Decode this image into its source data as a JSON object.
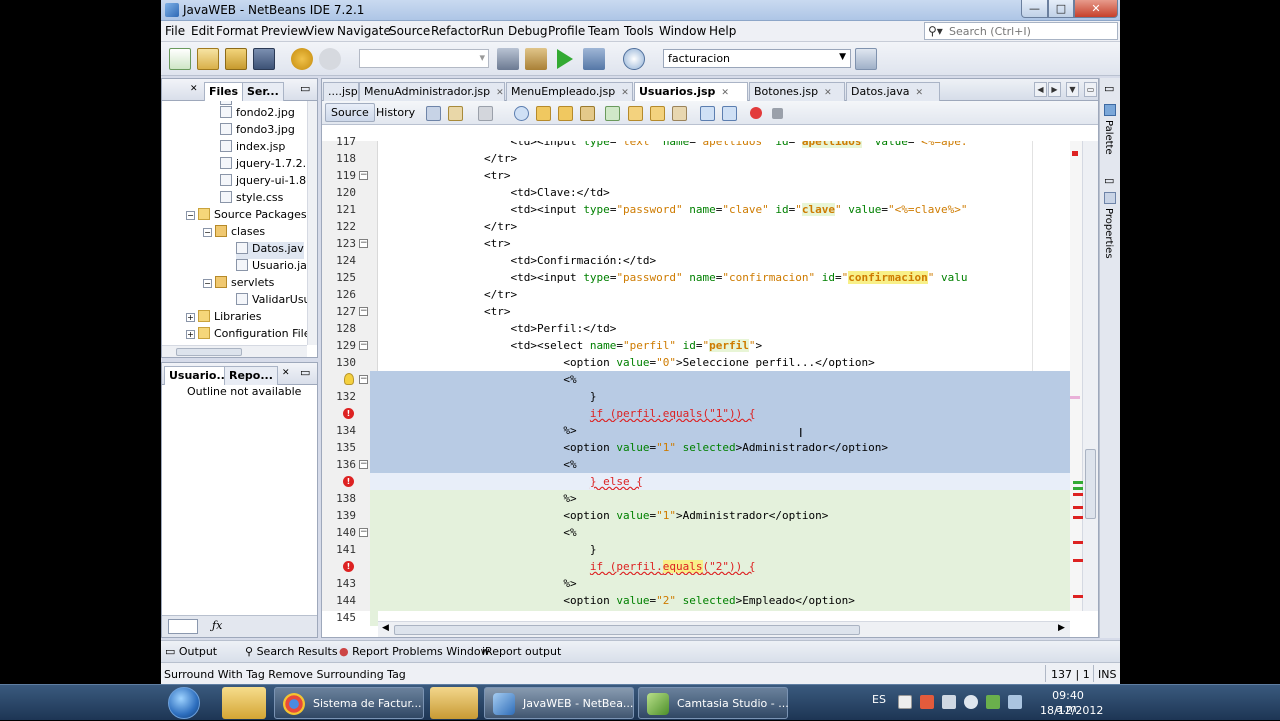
{
  "window": {
    "title": "JavaWEB - NetBeans IDE 7.2.1",
    "minimize": "—",
    "maximize": "□",
    "close": "✕"
  },
  "menu": [
    "File",
    "Edit",
    "Format",
    "Preview",
    "View",
    "Navigate",
    "Source",
    "Refactor",
    "Run",
    "Debug",
    "Profile",
    "Team",
    "Tools",
    "Window",
    "Help"
  ],
  "search": {
    "placeholder": "Search (Ctrl+I)"
  },
  "toolbar": {
    "project_combo": "facturacion"
  },
  "left_panel": {
    "tabs": [
      "Files",
      "Ser..."
    ],
    "tree": [
      {
        "label": "fondo2.jpg",
        "kind": "file"
      },
      {
        "label": "fondo3.jpg",
        "kind": "file"
      },
      {
        "label": "index.jsp",
        "kind": "file"
      },
      {
        "label": "jquery-1.7.2.",
        "kind": "file"
      },
      {
        "label": "jquery-ui-1.8",
        "kind": "file"
      },
      {
        "label": "style.css",
        "kind": "file"
      },
      {
        "label": "Source Packages",
        "kind": "folder"
      },
      {
        "label": "clases",
        "kind": "pkg"
      },
      {
        "label": "Datos.jav",
        "kind": "file"
      },
      {
        "label": "Usuario.ja",
        "kind": "file"
      },
      {
        "label": "servlets",
        "kind": "pkg"
      },
      {
        "label": "ValidarUsu",
        "kind": "file"
      },
      {
        "label": "Libraries",
        "kind": "folder"
      },
      {
        "label": "Configuration File",
        "kind": "folder"
      }
    ]
  },
  "navigator": {
    "tabs": [
      "Usuario...",
      "Repo..."
    ],
    "note": "Outline not available"
  },
  "editor": {
    "tabs": [
      {
        "label": "....jsp"
      },
      {
        "label": "MenuAdministrador.jsp"
      },
      {
        "label": "MenuEmpleado.jsp"
      },
      {
        "label": "Usuarios.jsp",
        "active": true
      },
      {
        "label": "Botones.jsp"
      },
      {
        "label": "Datos.java"
      }
    ],
    "source_tab": "Source",
    "history_tab": "History",
    "lines": [
      {
        "n": "117",
        "html": "                    &lt;td&gt;&lt;input <span class='a'>type</span>=<span class='v'>\"text\"</span> <span class='a'>name</span>=<span class='v'>\"apellidos\"</span> <span class='a'>id</span>=<span class='v'>\"<b class='hl-occ'>apellidos</b>\"</span> <span class='a'>value</span>=<span class='v'>\"&lt;%=ape:</span>"
      },
      {
        "n": "118",
        "html": "                &lt;/tr&gt;"
      },
      {
        "n": "119",
        "html": "                &lt;tr&gt;",
        "fold": true
      },
      {
        "n": "120",
        "html": "                    &lt;td&gt;Clave:&lt;/td&gt;"
      },
      {
        "n": "121",
        "html": "                    &lt;td&gt;&lt;input <span class='a'>type</span>=<span class='v'>\"password\"</span> <span class='a'>name</span>=<span class='v'>\"clave\"</span> <span class='a'>id</span>=<span class='v'>\"<b class='hl-occ'>clave</b>\"</span> <span class='a'>value</span>=<span class='v'>\"&lt;%=clave%&gt;\"</span>"
      },
      {
        "n": "122",
        "html": "                &lt;/tr&gt;"
      },
      {
        "n": "123",
        "html": "                &lt;tr&gt;",
        "fold": true
      },
      {
        "n": "124",
        "html": "                    &lt;td&gt;Confirmación:&lt;/td&gt;"
      },
      {
        "n": "125",
        "html": "                    &lt;td&gt;&lt;input <span class='a'>type</span>=<span class='v'>\"password\"</span> <span class='a'>name</span>=<span class='v'>\"confirmacion\"</span> <span class='a'>id</span>=<span class='v'>\"<b class='hl-yel'>confirmacion</b>\"</span> <span class='a'>valu</span>"
      },
      {
        "n": "126",
        "html": "                &lt;/tr&gt;"
      },
      {
        "n": "127",
        "html": "                &lt;tr&gt;",
        "fold": true
      },
      {
        "n": "128",
        "html": "                    &lt;td&gt;Perfil:&lt;/td&gt;"
      },
      {
        "n": "129",
        "html": "                    &lt;td&gt;&lt;select <span class='a'>name</span>=<span class='v'>\"perfil\"</span> <span class='a'>id</span>=<span class='v'>\"<b class='hl-occ'>perfil</b>\"</span>&gt;",
        "fold": true
      },
      {
        "n": "130",
        "html": "                            &lt;option <span class='a'>value</span>=<span class='v'>\"0\"</span>&gt;Seleccione perfil...&lt;/option&gt;"
      },
      {
        "n": "",
        "html": "                            &lt;%",
        "bg": "sel",
        "bulb": true,
        "fold": true
      },
      {
        "n": "132",
        "html": "                                }",
        "bg": "sel"
      },
      {
        "n": "",
        "html": "                                <span class='err'>if (perfil.equals(\"1\")) {</span>",
        "bg": "sel",
        "err": true
      },
      {
        "n": "134",
        "html": "                            %&gt;",
        "bg": "sel"
      },
      {
        "n": "135",
        "html": "                            &lt;option <span class='a'>value</span>=<span class='v'>\"1\"</span> <span class='a'>selected</span>&gt;Administrador&lt;/option&gt;",
        "bg": "sel"
      },
      {
        "n": "136",
        "html": "                            &lt;%",
        "bg": "sel",
        "fold": true
      },
      {
        "n": "",
        "html": "                                <span class='err'>} else {</span>",
        "bg": "cur",
        "err": true
      },
      {
        "n": "138",
        "html": "                            %&gt;",
        "bg": "grn"
      },
      {
        "n": "139",
        "html": "                            &lt;option <span class='a'>value</span>=<span class='v'>\"1\"</span>&gt;Administrador&lt;/option&gt;",
        "bg": "grn"
      },
      {
        "n": "140",
        "html": "                            &lt;%",
        "bg": "grn",
        "fold": true
      },
      {
        "n": "141",
        "html": "                                }",
        "bg": "grn"
      },
      {
        "n": "",
        "html": "                                <span class='err'>if (perfil.<span class='hl-yel'>equals</span>(\"2\")) {</span>",
        "bg": "grn",
        "err": true
      },
      {
        "n": "143",
        "html": "                            %&gt;",
        "bg": "grn"
      },
      {
        "n": "144",
        "html": "                            &lt;option <span class='a'>value</span>=<span class='v'>\"2\"</span> <span class='a'>selected</span>&gt;Empleado&lt;/option&gt;",
        "bg": "grn"
      },
      {
        "n": "145",
        "html": "                            &lt;%",
        "bg": "grn"
      }
    ]
  },
  "right_strip": [
    "Palette",
    "Properties"
  ],
  "output_bar": [
    "Output",
    "Search Results",
    "Report Problems Window",
    "iReport output"
  ],
  "status": {
    "left": "Surround With Tag  Remove Surrounding Tag",
    "position": "137 | 1",
    "mode": "INS"
  },
  "taskbar": {
    "tasks": [
      "Sistema de Factur...",
      "JavaWEB - NetBea...",
      "Camtasia Studio - ..."
    ],
    "lang": "ES",
    "time": "09:40 a.m.",
    "date": "18/12/2012"
  },
  "colors": {
    "selection": "#b8cbe4",
    "changed_green": "#e4f1dc",
    "current_line": "#e8eef9",
    "error": "#dd2222"
  }
}
